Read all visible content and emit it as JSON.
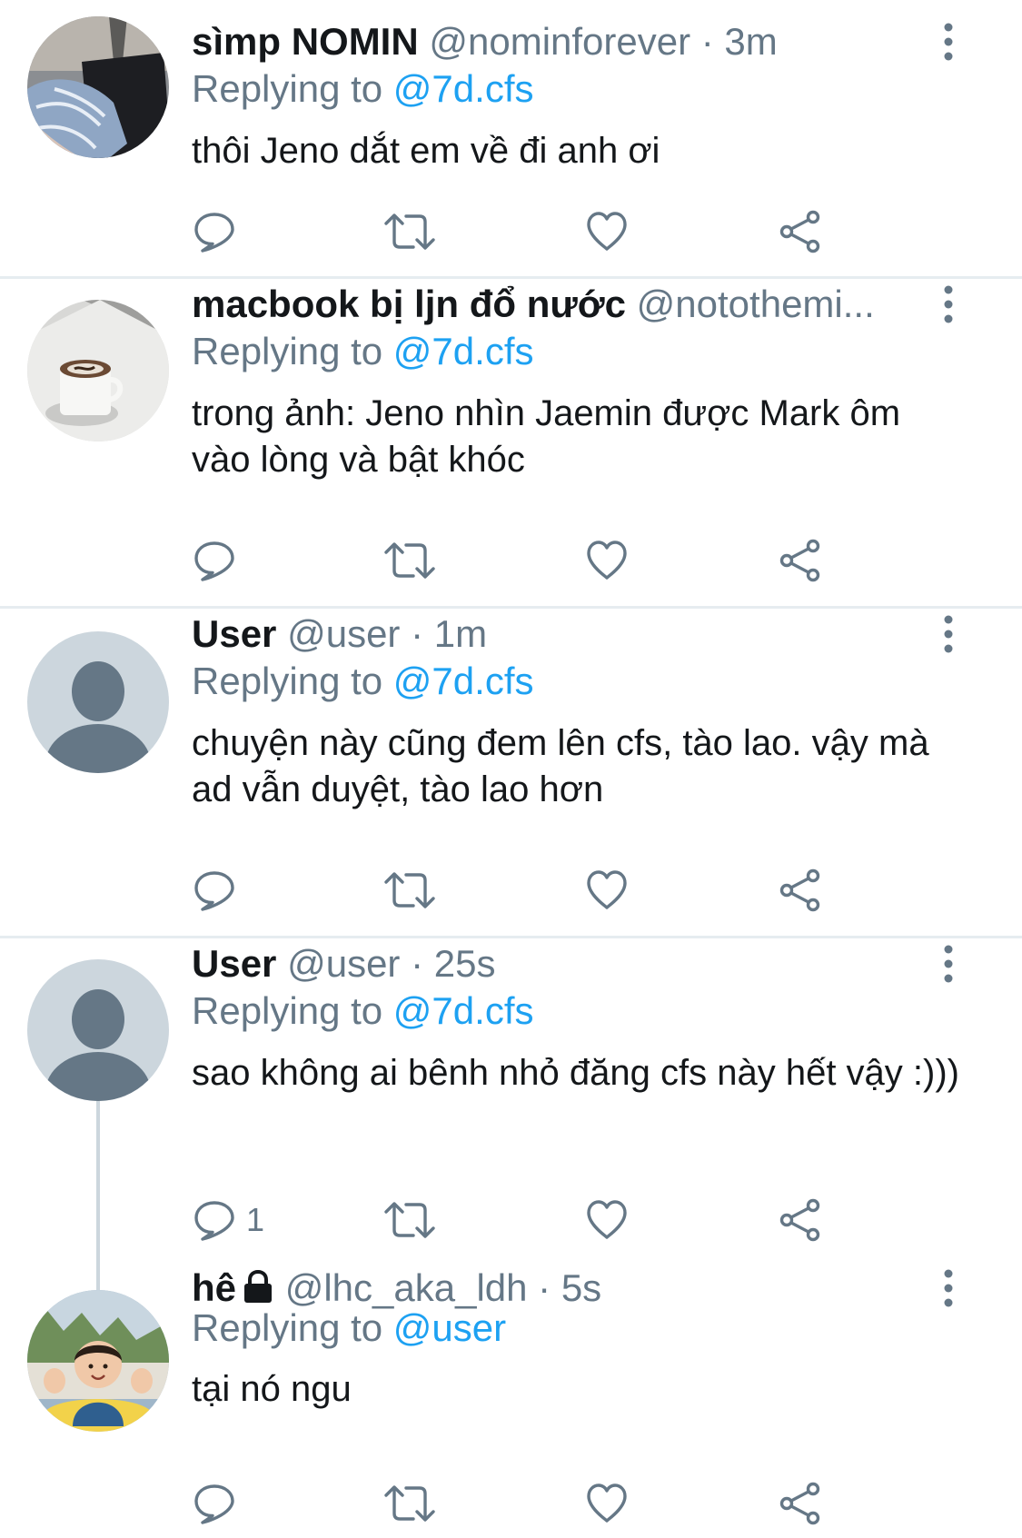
{
  "colors": {
    "accent": "#1da1f2",
    "secondary_text": "#657786",
    "divider": "#e6ecf0",
    "thread_line": "#ccd6dd"
  },
  "icons": {
    "reply": "speech-bubble-icon",
    "retweet": "retweet-icon",
    "like": "heart-icon",
    "share": "share-icon",
    "more": "vertical-ellipsis-icon",
    "protected": "lock-icon"
  },
  "replies": [
    {
      "name": "sìmp NOMIN",
      "handle": "@nominforever",
      "time": "· 3m",
      "replying_prefix": "Replying to",
      "replying_to": "@7d.cfs",
      "text": "thôi Jeno dắt em về đi anh ơi",
      "reply_count": ""
    },
    {
      "name": "macbook bị ljn đổ nước",
      "handle": "@notothemi...",
      "time": "",
      "replying_prefix": "Replying to",
      "replying_to": "@7d.cfs",
      "text": "trong ảnh: Jeno nhìn Jaemin được Mark ôm vào lòng và bật khóc",
      "reply_count": ""
    },
    {
      "name": "User",
      "handle": "@user",
      "time": "· 1m",
      "replying_prefix": "Replying to",
      "replying_to": "@7d.cfs",
      "text": "chuyện này cũng đem lên cfs, tào lao. vậy mà ad vẫn duyệt, tào lao hơn",
      "reply_count": ""
    },
    {
      "name": "User",
      "handle": "@user",
      "time": "· 25s",
      "replying_prefix": "Replying to",
      "replying_to": "@7d.cfs",
      "text": "sao không ai bênh nhỏ đăng cfs này hết vậy :)))",
      "reply_count": "1"
    },
    {
      "name": "hê",
      "handle": "@lhc_aka_ldh",
      "time": "· 5s",
      "replying_prefix": "Replying to",
      "replying_to": "@user",
      "text": "tại nó ngu",
      "reply_count": ""
    }
  ]
}
